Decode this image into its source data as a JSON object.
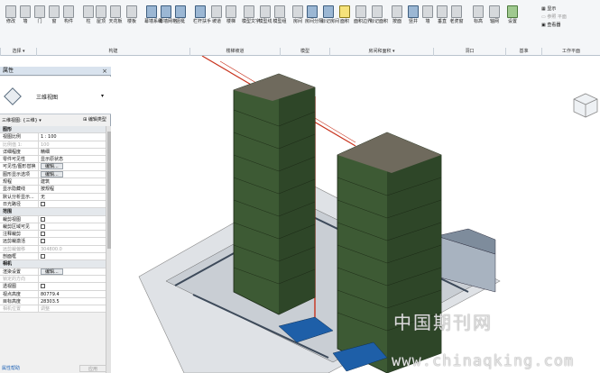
{
  "ribbon": {
    "tools": [
      {
        "label": "修改",
        "icon": "cursor-icon",
        "color": "gray"
      },
      {
        "label": "墙",
        "icon": "wall-icon",
        "color": "gray"
      },
      {
        "label": "门",
        "icon": "door-icon",
        "color": "gray"
      },
      {
        "label": "窗",
        "icon": "window-icon",
        "color": "gray"
      },
      {
        "label": "构件",
        "icon": "component-icon",
        "color": "gray"
      },
      {
        "label": "柱",
        "icon": "column-icon",
        "color": "gray"
      },
      {
        "label": "屋顶",
        "icon": "roof-icon",
        "color": "gray"
      },
      {
        "label": "天花板",
        "icon": "ceiling-icon",
        "color": "gray"
      },
      {
        "label": "楼板",
        "icon": "floor-icon",
        "color": "gray"
      },
      {
        "label": "幕墙系统",
        "icon": "curtain-system-icon",
        "color": "blue"
      },
      {
        "label": "幕墙网格",
        "icon": "curtain-grid-icon",
        "color": "blue"
      },
      {
        "label": "竖梃",
        "icon": "mullion-icon",
        "color": "blue"
      },
      {
        "label": "栏杆扶手",
        "icon": "railing-icon",
        "color": "blue"
      },
      {
        "label": "坡道",
        "icon": "ramp-icon",
        "color": "gray"
      },
      {
        "label": "楼梯",
        "icon": "stair-icon",
        "color": "gray"
      },
      {
        "label": "模型文字",
        "icon": "model-text-icon",
        "color": "gray"
      },
      {
        "label": "模型线",
        "icon": "model-line-icon",
        "color": "gray"
      },
      {
        "label": "模型组",
        "icon": "model-group-icon",
        "color": "gray"
      },
      {
        "label": "房间",
        "icon": "room-icon",
        "color": "gray"
      },
      {
        "label": "房间分隔",
        "icon": "room-separator-icon",
        "color": "blue"
      },
      {
        "label": "标记房间",
        "icon": "tag-room-icon",
        "color": "blue"
      },
      {
        "label": "面积",
        "icon": "area-icon",
        "color": "yellow"
      },
      {
        "label": "面积边界",
        "icon": "area-boundary-icon",
        "color": "gray"
      },
      {
        "label": "标记面积",
        "icon": "tag-area-icon",
        "color": "gray"
      },
      {
        "label": "按面",
        "icon": "by-face-icon",
        "color": "gray"
      },
      {
        "label": "竖井",
        "icon": "shaft-icon",
        "color": "blue"
      },
      {
        "label": "墙",
        "icon": "wall-opening-icon",
        "color": "gray"
      },
      {
        "label": "垂直",
        "icon": "vertical-icon",
        "color": "gray"
      },
      {
        "label": "老虎窗",
        "icon": "dormer-icon",
        "color": "gray"
      },
      {
        "label": "标高",
        "icon": "level-icon",
        "color": "gray"
      },
      {
        "label": "轴网",
        "icon": "grid-icon",
        "color": "gray"
      },
      {
        "label": "设置",
        "icon": "settings-icon",
        "color": "green"
      }
    ],
    "panels": [
      {
        "label": "选择 ▾"
      },
      {
        "label": "构建"
      },
      {
        "label": "楼梯坡道"
      },
      {
        "label": "模型"
      },
      {
        "label": "房间和面积 ▾"
      },
      {
        "label": "洞口"
      },
      {
        "label": "基准"
      },
      {
        "label": "工作平面"
      }
    ],
    "side": {
      "show": "显示",
      "ref_plane": "参照 平面",
      "viewer": "查看器"
    }
  },
  "properties": {
    "title": "属性",
    "close": "×",
    "type_name": "三维视图",
    "selector": "三维视图: {三维}",
    "edit_type": "编辑类型",
    "rows": [
      {
        "k": "图形",
        "v": "",
        "sec": true
      },
      {
        "k": "视图比例",
        "v": "1 : 100"
      },
      {
        "k": "比例值 1:",
        "v": "100",
        "dim": true
      },
      {
        "k": "详细程度",
        "v": "精细"
      },
      {
        "k": "零件可见性",
        "v": "显示原状态"
      },
      {
        "k": "可见性/图形替换",
        "v": "编辑...",
        "btn": true
      },
      {
        "k": "图形显示选项",
        "v": "编辑...",
        "btn": true
      },
      {
        "k": "规程",
        "v": "建筑"
      },
      {
        "k": "显示隐藏线",
        "v": "按规程"
      },
      {
        "k": "默认分析显示...",
        "v": "无"
      },
      {
        "k": "日光路径",
        "v": "",
        "cb": true
      },
      {
        "k": "范围",
        "v": "",
        "sec": true
      },
      {
        "k": "裁剪视图",
        "v": "",
        "cb": true
      },
      {
        "k": "裁剪区域可见",
        "v": "",
        "cb": true
      },
      {
        "k": "注释裁剪",
        "v": "",
        "cb": true
      },
      {
        "k": "远剪裁激活",
        "v": "",
        "cb": true
      },
      {
        "k": "远剪裁偏移",
        "v": "304800.0",
        "dim": true
      },
      {
        "k": "剖面框",
        "v": "",
        "cb": true
      },
      {
        "k": "相机",
        "v": "",
        "sec": true
      },
      {
        "k": "渲染设置",
        "v": "编辑...",
        "btn": true
      },
      {
        "k": "锁定的方向",
        "v": "",
        "dim": true
      },
      {
        "k": "透视图",
        "v": "",
        "cb": true
      },
      {
        "k": "视点高度",
        "v": "80779.4"
      },
      {
        "k": "目标高度",
        "v": "28303.5"
      },
      {
        "k": "相机位置",
        "v": "调整",
        "dim": true
      }
    ],
    "help": "属性帮助",
    "apply": "应用"
  },
  "watermark": {
    "cn": "中国期刊网",
    "url": "www.chinaqking.com"
  }
}
